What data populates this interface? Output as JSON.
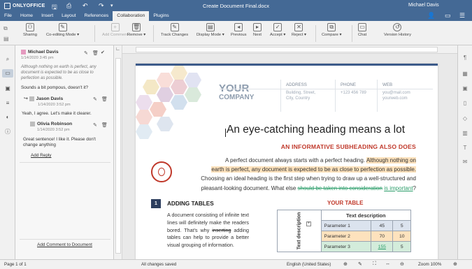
{
  "app": {
    "logo": "ONLYOFFICE",
    "title": "Create Document Final.docx",
    "user": "Michael Davis"
  },
  "menu": [
    "File",
    "Home",
    "Insert",
    "Layout",
    "References",
    "Collaboration",
    "Plugins"
  ],
  "toolbar": {
    "sharing": "Sharing",
    "coediting": "Co-editing Mode ▾",
    "add_comment": "Add Comment",
    "remove": "Remove ▾",
    "track_changes": "Track Changes",
    "display_mode": "Display Mode ▾",
    "previous": "Previous",
    "next": "Next",
    "accept": "Accept ▾",
    "reject": "Reject ▾",
    "compare": "Compare ▾",
    "chat": "Chat",
    "version_history": "Version History"
  },
  "comments": {
    "c1": {
      "name": "Michael Davis",
      "date": "1/14/2020 3:45 pm",
      "quote": "Although nothing on earth is perfect, any document is expected to be as close to perfection as possible.",
      "text": "Sounds a bit pompous, doesn't it?"
    },
    "r1": {
      "name": "Jason Davis",
      "date": "1/14/2020 3:52 pm",
      "text": "Yeah, I agree. Let's make it clearer."
    },
    "r2": {
      "name": "Olivia Robinson",
      "date": "1/14/2020 3:52 pm",
      "text": "Great sentence! I like it. Please don't change anything"
    },
    "add_reply": "Add Reply",
    "add_comment_doc": "Add Comment to Document",
    "colors": {
      "c1": "#e59abf",
      "r1": "#bdbdbd",
      "r2": "#bdbdbd"
    }
  },
  "doc": {
    "company_a": "YOUR",
    "company_b": "COMPANY",
    "address_h": "ADDRESS",
    "address_1": "Building, Street,",
    "address_2": "City, Country",
    "phone_h": "PHONE",
    "phone_1": "+123 456 789",
    "web_h": "WEB",
    "web_1": "you@mail.com",
    "web_2": "yourweb.com",
    "heading": "An eye-catching heading means a lot",
    "subheading": "AN INFORMATIVE SUBHEADING ALSO DOES",
    "p1": "A perfect document always starts with a perfect heading.",
    "p1_hl_a": "Although nothing on",
    "p1_hl_b": "earth is perfect, any document is expected to be as close to perfection as possible.",
    "p2": "Choosing an ideal heading is the first step when trying to draw up a well-structured and",
    "p3_a": "pleasant-looking document. What else",
    "p3_del": "should be taken into consideration",
    "p3_ins": "is important",
    "p3_end": "?",
    "sec_num": "1",
    "sec_title": "ADDING TABLES",
    "sec_text_a": "A document consisting of infinite text lines will definitely make the readers bored. That's why",
    "sec_text_del": "inserting",
    "sec_text_b": "adding tables can help to provide a better visual grouping of information.",
    "table_title": "YOUR TABLE",
    "table": {
      "header": "Text description",
      "side": "Text description",
      "rows": [
        {
          "label": "Parameter 1",
          "a": "45",
          "b": "5"
        },
        {
          "label": "Parameter 2",
          "a": "70",
          "b": "10"
        },
        {
          "label": "Parameter 3",
          "a": "155",
          "b": "5"
        }
      ]
    }
  },
  "status": {
    "page": "Page 1 of 1",
    "saved": "All changes saved",
    "language": "English (United States)",
    "zoom": "Zoom 100%"
  }
}
